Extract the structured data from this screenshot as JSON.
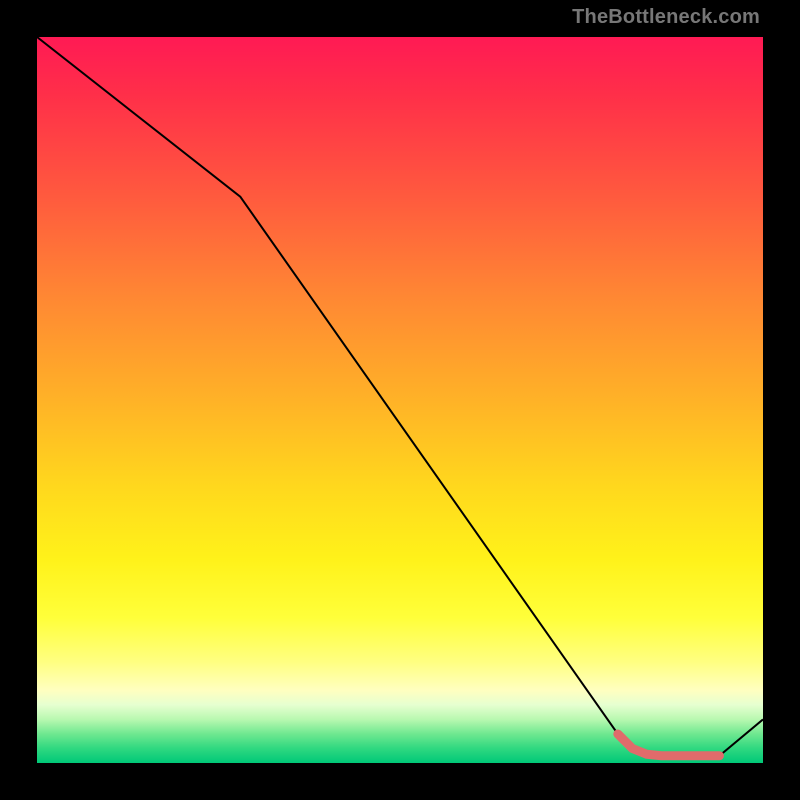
{
  "watermark": "TheBottleneck.com",
  "chart_data": {
    "type": "line",
    "title": "",
    "xlabel": "",
    "ylabel": "",
    "xlim": [
      0,
      100
    ],
    "ylim": [
      0,
      100
    ],
    "series": [
      {
        "name": "bottleneck-curve",
        "color": "#000000",
        "width": 2,
        "x": [
          0,
          28,
          80,
          82,
          84,
          86,
          88,
          90,
          94,
          100
        ],
        "y": [
          100,
          78,
          4,
          2,
          1.2,
          1.0,
          1.0,
          1.0,
          1.0,
          6
        ]
      },
      {
        "name": "highlight-segment",
        "color": "#e06b6b",
        "width": 9,
        "linecap": "round",
        "x": [
          80,
          82,
          84,
          86,
          88,
          90,
          94
        ],
        "y": [
          4,
          2,
          1.2,
          1.0,
          1.0,
          1.0,
          1.0
        ]
      }
    ],
    "background_gradient": {
      "orientation": "vertical",
      "stops": [
        {
          "pos": 0.0,
          "color": "#ff1a54"
        },
        {
          "pos": 0.5,
          "color": "#ffb227"
        },
        {
          "pos": 0.8,
          "color": "#ffff3a"
        },
        {
          "pos": 0.92,
          "color": "#e6ffd0"
        },
        {
          "pos": 1.0,
          "color": "#00c878"
        }
      ]
    }
  }
}
